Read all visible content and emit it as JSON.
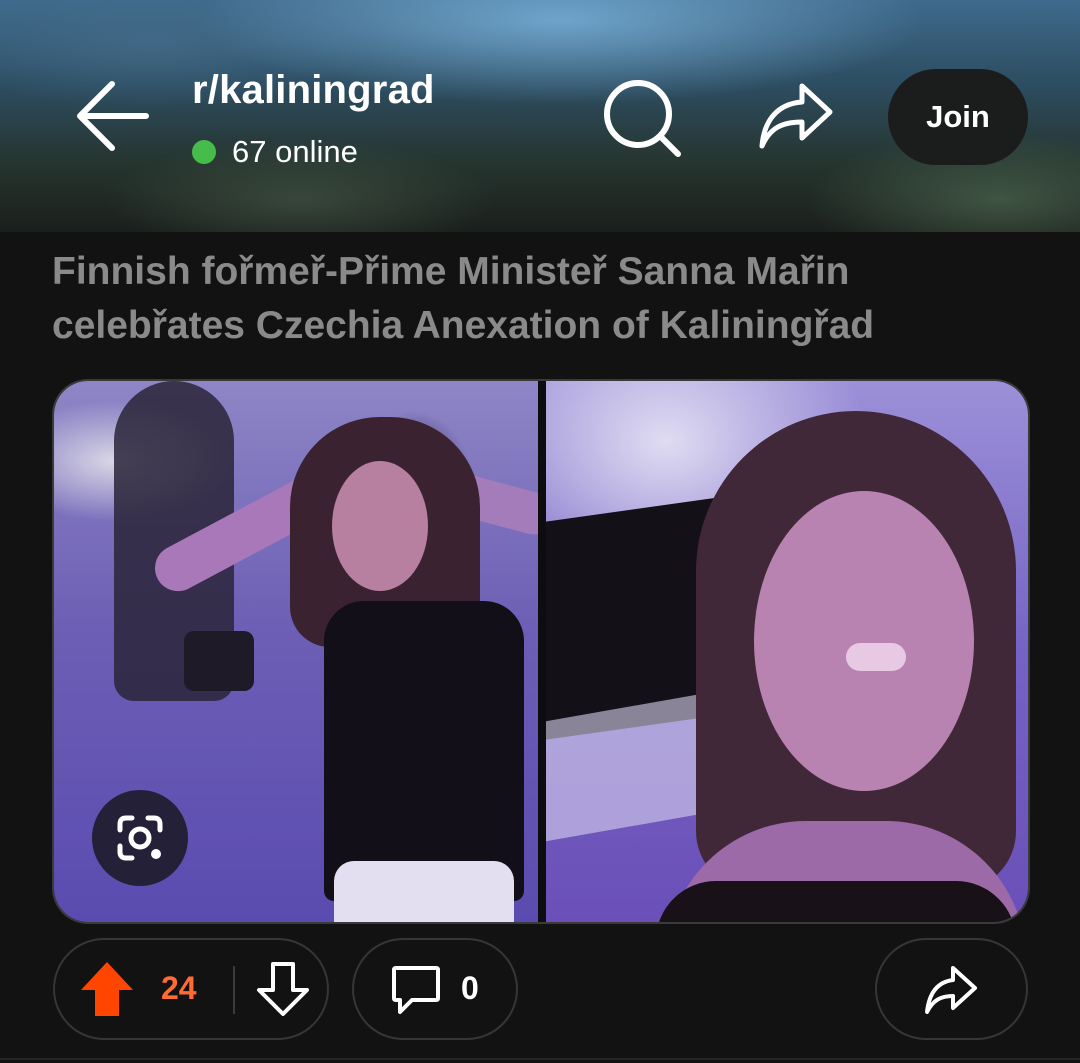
{
  "header": {
    "subreddit": "r/kaliningrad",
    "online_text": "67 online",
    "join_label": "Join",
    "icons": [
      "back-arrow-icon",
      "search-icon",
      "share-icon"
    ]
  },
  "post": {
    "title": "Finnish fořmeř-Přime Ministeř Sanna Mařin celebřates Czechia Anexation of Kaliningřad",
    "media_icon": "lens-search-icon"
  },
  "actions": {
    "upvotes": "24",
    "comments": "0",
    "upvote_color": "#ff4500",
    "icons": [
      "upvote-icon",
      "downvote-icon",
      "comment-icon",
      "share-icon"
    ]
  },
  "colors": {
    "background": "#121212",
    "online_dot": "#46bd4a",
    "vote_count": "#ff6b33",
    "title": "#8a8a8a"
  }
}
